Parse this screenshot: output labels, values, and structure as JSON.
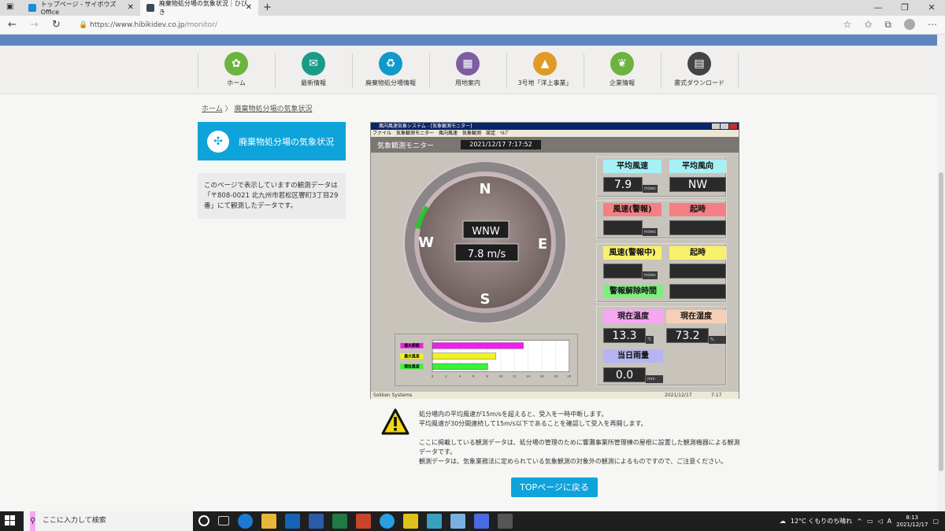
{
  "browser": {
    "tabs": [
      {
        "label": "トップページ - サイボウズ Office",
        "active": false
      },
      {
        "label": "廃棄物処分場の気象状況｜ひびき",
        "active": true
      }
    ],
    "url_host": "https://www.hibikidev.co.jp",
    "url_path": "/monitor/"
  },
  "nav": {
    "items": [
      {
        "label": "ホーム",
        "color": "#6cb33f"
      },
      {
        "label": "最新情報",
        "color": "#1a9b89"
      },
      {
        "label": "廃棄物処分場情報",
        "color": "#1199cc"
      },
      {
        "label": "用地案内",
        "color": "#7c5fa0"
      },
      {
        "label": "3号地「洋上事業」",
        "color": "#e09a26"
      },
      {
        "label": "企業情報",
        "color": "#6cb33f"
      },
      {
        "label": "書式ダウンロード",
        "color": "#444444"
      }
    ]
  },
  "breadcrumb": {
    "home": "ホーム",
    "sep": "〉",
    "current": "廃棄物処分場の気象状況"
  },
  "side": {
    "heading": "廃棄物処分場の気象状況",
    "text": "このページで表示していますの観測データは「〒808-0021 北九州市若松区響町3丁目29番」にて観測したデータです。"
  },
  "monitor": {
    "window_title": "風向風速気象システム - [気象観測モニター]",
    "menu": [
      "ファイル",
      "気象観測モニター",
      "風向風速",
      "気象観測",
      "設定",
      "ﾍﾙﾌﾟ"
    ],
    "header_label": "気象観測モニター",
    "datetime": "2021/12/17 7:17:52",
    "compass": {
      "n": "N",
      "e": "E",
      "s": "S",
      "w": "W",
      "direction": "WNW",
      "speed": "7.8 m/s"
    },
    "avg_speed_label": "平均風速",
    "avg_speed": "7.9",
    "avg_speed_unit": "m/sec",
    "avg_dir_label": "平均風向",
    "avg_dir": "NW",
    "alarm_speed_label": "風速(警報)",
    "alarm_speed_unit": "m/sec",
    "alarm_time_label": "起時",
    "warn_speed_label": "風速(警報中)",
    "warn_speed_unit": "m/sec",
    "warn_time_label": "起時",
    "release_label": "警報解除時間",
    "temp_label": "現在温度",
    "temp": "13.3",
    "temp_unit": "℃",
    "humid_label": "現在湿度",
    "humid": "73.2",
    "humid_unit": "%",
    "rain_label": "当日雨量",
    "rain": "0.0",
    "rain_unit": "mm",
    "footer_left": "Sokken Systems",
    "footer_date": "2021/12/17",
    "footer_time": "7:17",
    "colors": {
      "max_instant": "#f21df0",
      "max_wind": "#f2f21d",
      "current": "#3af23a"
    }
  },
  "chart_data": {
    "type": "bar",
    "categories": [
      "最大瞬間",
      "最大風速",
      "現在風速"
    ],
    "values": [
      13.3,
      9.3,
      8.1
    ],
    "xlim": [
      0,
      20
    ],
    "xticks": [
      0,
      2,
      4,
      6,
      8,
      10,
      12,
      14,
      16,
      18,
      20
    ]
  },
  "notice": {
    "line1": "処分場内の平均風速が15m/sを超えると、受入を一時中断します。",
    "line2": "平均風速が30分間連続して15m/s以下であることを確認して受入を再開します。",
    "line3": "ここに掲載している観測データは、処分場の管理のために響灘事業所管理棟の屋根に設置した観測機器による観測データです。",
    "line4": "観測データは、気象業務法に定められている気象観測の対象外の観測によるものですので、ご注意ください。"
  },
  "top_button": "TOPページに戻る",
  "taskbar": {
    "search_placeholder": "ここに入力して検索",
    "weather": "12°C くもりのち晴れ",
    "ime": "A",
    "time": "8:13",
    "date": "2021/12/17"
  }
}
